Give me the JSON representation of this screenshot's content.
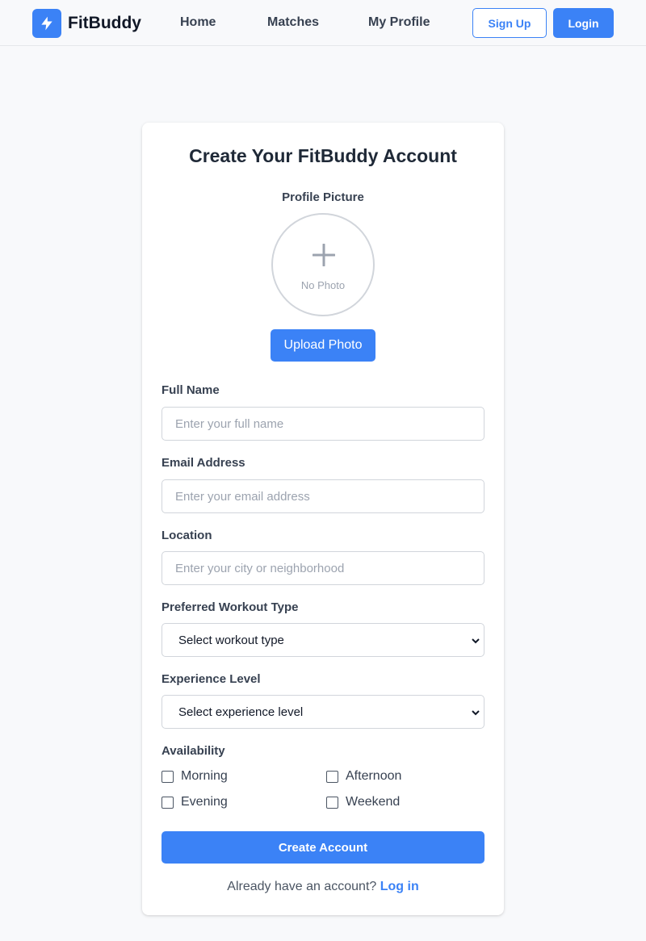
{
  "nav": {
    "brand_name": "FitBuddy",
    "brand_icon": "lightning-icon",
    "links": [
      "Home",
      "Matches",
      "My Profile"
    ],
    "signup_label": "Sign Up",
    "login_label": "Login"
  },
  "form": {
    "title": "Create Your FitBuddy Account",
    "picture_label": "Profile Picture",
    "picture_icon": "plus-icon",
    "no_photo_text": "No Photo",
    "upload_label": "Upload Photo",
    "fields": {
      "full_name": {
        "label": "Full Name",
        "placeholder": "Enter your full name"
      },
      "email": {
        "label": "Email Address",
        "placeholder": "Enter your email address"
      },
      "location": {
        "label": "Location",
        "placeholder": "Enter your city or neighborhood"
      },
      "workout_type": {
        "label": "Preferred Workout Type",
        "selected": "Select workout type"
      },
      "experience": {
        "label": "Experience Level",
        "selected": "Select experience level"
      }
    },
    "availability": {
      "label": "Availability",
      "options": [
        "Morning",
        "Afternoon",
        "Evening",
        "Weekend"
      ]
    },
    "submit_label": "Create Account",
    "footer_text": "Already have an account?",
    "footer_link": "Log in"
  },
  "colors": {
    "accent": "#3b82f6",
    "page_bg": "#f8f9fb",
    "card_bg": "#ffffff",
    "text": "#1f2937"
  }
}
